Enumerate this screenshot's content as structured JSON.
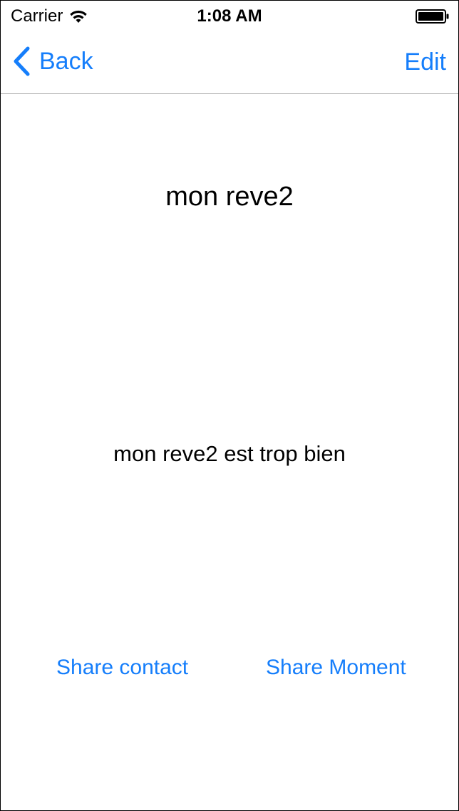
{
  "status_bar": {
    "carrier": "Carrier",
    "time": "1:08 AM",
    "wifi_icon": "wifi-icon",
    "battery_icon": "battery-icon"
  },
  "nav_bar": {
    "back_label": "Back",
    "back_icon": "chevron-left-icon",
    "edit_label": "Edit"
  },
  "content": {
    "title": "mon reve2",
    "description": "mon reve2 est trop bien"
  },
  "actions": {
    "share_contact_label": "Share contact",
    "share_moment_label": "Share Moment"
  },
  "colors": {
    "accent": "#157efb",
    "text": "#000000",
    "separator": "#b2b2b2",
    "background": "#ffffff"
  }
}
